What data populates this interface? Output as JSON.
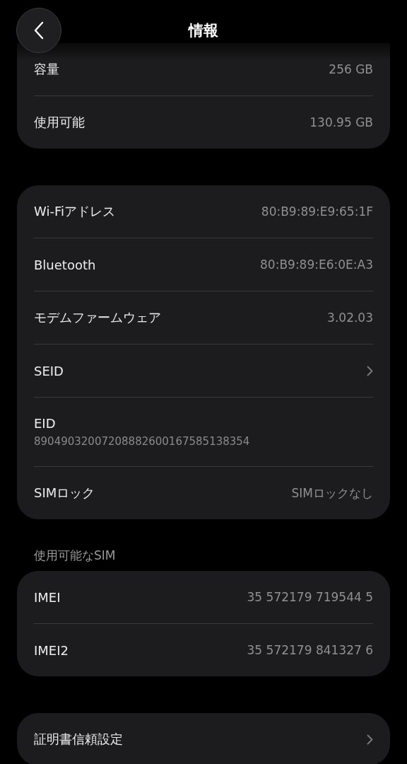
{
  "header": {
    "title": "情報"
  },
  "groups": [
    {
      "rows": [
        {
          "kind": "value",
          "label": "容量",
          "value": "256 GB"
        },
        {
          "kind": "value",
          "label": "使用可能",
          "value": "130.95 GB"
        }
      ]
    },
    {
      "rows": [
        {
          "kind": "value",
          "label": "Wi-Fiアドレス",
          "value": "80:B9:89:E9:65:1F"
        },
        {
          "kind": "value",
          "label": "Bluetooth",
          "value": "80:B9:89:E6:0E:A3"
        },
        {
          "kind": "value",
          "label": "モデムファームウェア",
          "value": "3.02.03"
        },
        {
          "kind": "link",
          "label": "SEID"
        },
        {
          "kind": "stacked",
          "label": "EID",
          "value": "89049032007208882600167585138354"
        },
        {
          "kind": "value",
          "label": "SIMロック",
          "value": "SIMロックなし"
        }
      ]
    },
    {
      "label": "使用可能なSIM",
      "rows": [
        {
          "kind": "value",
          "label": "IMEI",
          "value": "35 572179 719544 5"
        },
        {
          "kind": "value",
          "label": "IMEI2",
          "value": "35 572179 841327 6"
        }
      ]
    },
    {
      "rows": [
        {
          "kind": "link",
          "label": "証明書信頼設定"
        }
      ]
    }
  ]
}
